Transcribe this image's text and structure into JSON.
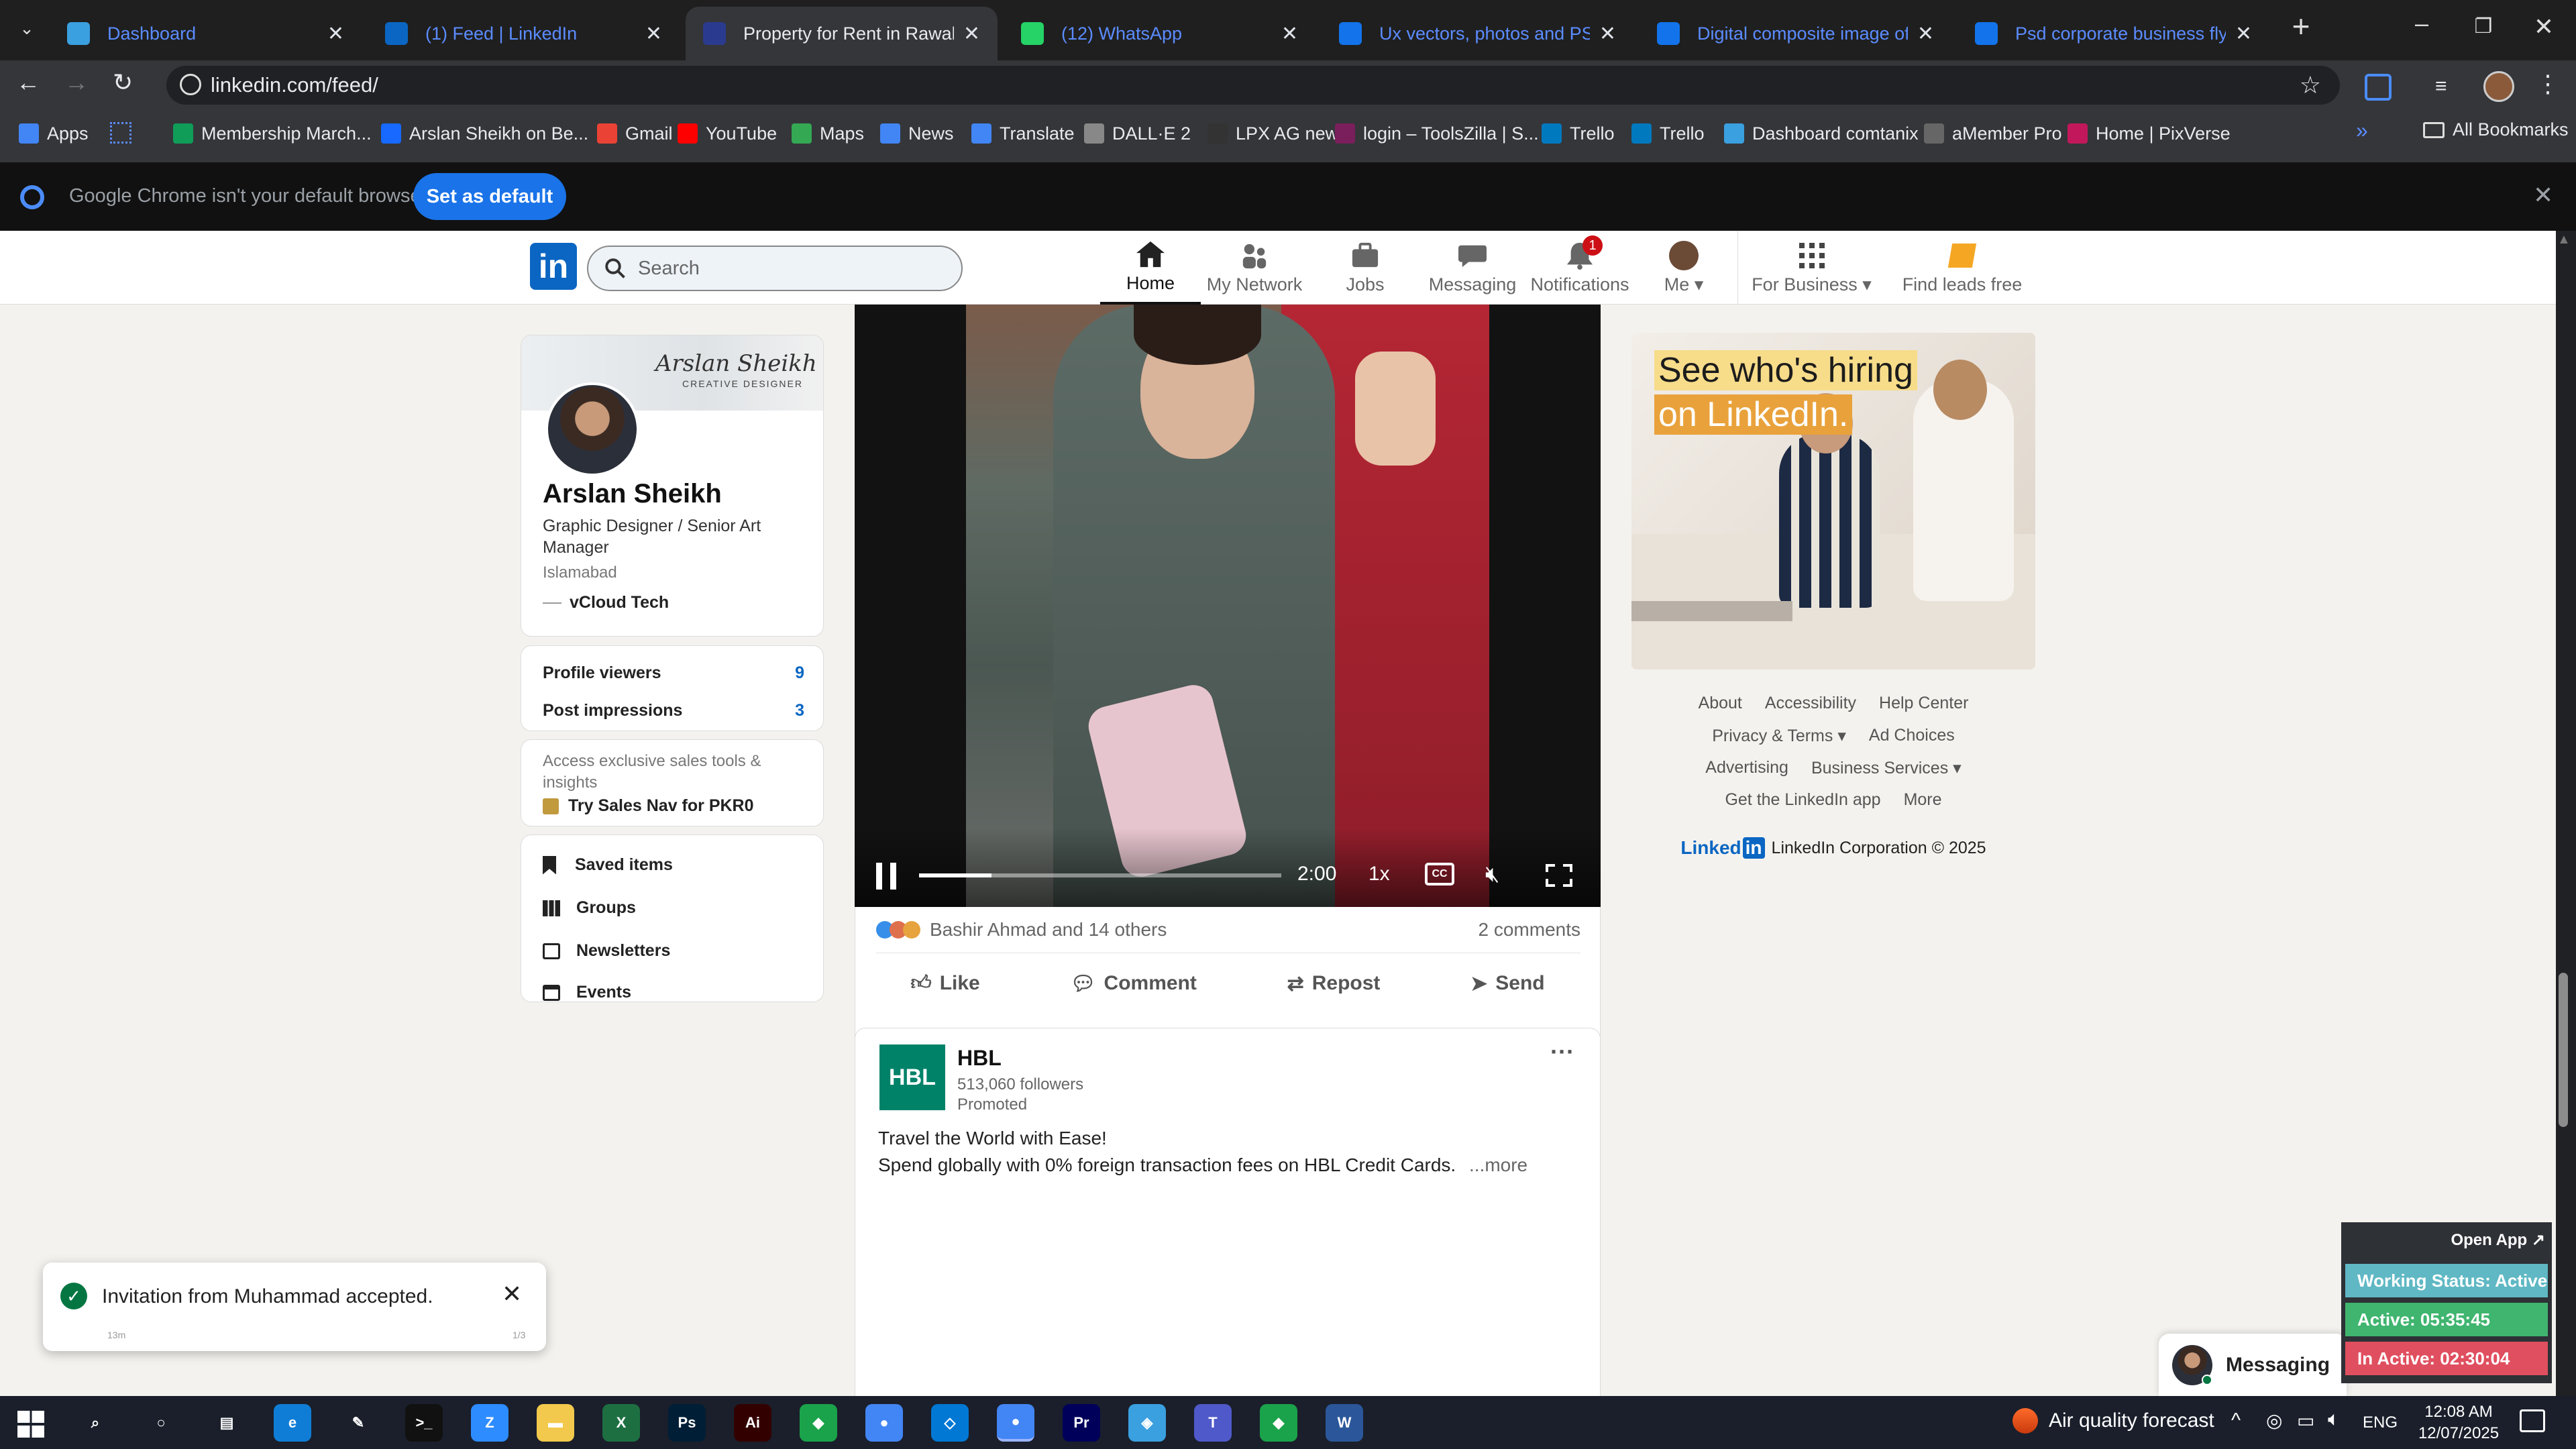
{
  "browser": {
    "tabs": [
      {
        "title": "Dashboard",
        "color": "#3aa0e0",
        "active": false
      },
      {
        "title": "(1) Feed | LinkedIn",
        "color": "#0a66c2",
        "active": false
      },
      {
        "title": "Property for Rent in Rawalpindi",
        "color": "#2a3b8f",
        "active": true
      },
      {
        "title": "(12) WhatsApp",
        "color": "#25d366",
        "active": false
      },
      {
        "title": "Ux vectors, photos and PSD files",
        "color": "#1273eb",
        "active": false
      },
      {
        "title": "Digital composite image of gra",
        "color": "#1273eb",
        "active": false
      },
      {
        "title": "Psd corporate business flyer de",
        "color": "#1273eb",
        "active": false
      }
    ],
    "url": "linkedin.com/feed/",
    "bookmarks": [
      {
        "label": "Apps",
        "color": "#4285f4"
      },
      {
        "label": "Membership March...",
        "color": "#0f9d58"
      },
      {
        "label": "Arslan Sheikh on Be...",
        "color": "#1769ff"
      },
      {
        "label": "Gmail",
        "color": "#ea4335"
      },
      {
        "label": "YouTube",
        "color": "#ff0000"
      },
      {
        "label": "Maps",
        "color": "#34a853"
      },
      {
        "label": "News",
        "color": "#4285f4"
      },
      {
        "label": "Translate",
        "color": "#4285f4"
      },
      {
        "label": "DALL·E 2",
        "color": "#888888"
      },
      {
        "label": "LPX AG new",
        "color": "#333333"
      },
      {
        "label": "login – ToolsZilla | S...",
        "color": "#7a1f5c"
      },
      {
        "label": "Trello",
        "color": "#0079bf"
      },
      {
        "label": "Trello",
        "color": "#0079bf"
      },
      {
        "label": "Dashboard comtanix",
        "color": "#3aa0e0"
      },
      {
        "label": "aMember Pro",
        "color": "#666666"
      },
      {
        "label": "Home | PixVerse",
        "color": "#c2185b"
      }
    ],
    "all_bookmarks": "All Bookmarks",
    "infobar_text": "Google Chrome isn't your default browser",
    "infobar_button": "Set as default"
  },
  "linkedin": {
    "search_placeholder": "Search",
    "nav": {
      "home": "Home",
      "network": "My Network",
      "jobs": "Jobs",
      "messaging": "Messaging",
      "notifications": "Notifications",
      "notifications_badge": "1",
      "me": "Me",
      "business": "For Business",
      "leads": "Find leads free"
    },
    "profile": {
      "banner_name": "Arslan Sheikh",
      "banner_sub": "CREATIVE DESIGNER",
      "name": "Arslan Sheikh",
      "headline": "Graphic Designer / Senior Art Manager",
      "location": "Islamabad",
      "company": "vCloud Tech",
      "viewers_label": "Profile viewers",
      "viewers": "9",
      "impressions_label": "Post impressions",
      "impressions": "3",
      "premium_text": "Access exclusive sales tools & insights",
      "premium_cta": "Try Sales Nav for PKR0"
    },
    "shortcuts": [
      "Saved items",
      "Groups",
      "Newsletters",
      "Events"
    ],
    "video": {
      "time": "2:00",
      "speed": "1x",
      "progress": 0.2
    },
    "post_social": {
      "reactions": "Bashir Ahmad and 14 others",
      "comments": "2 comments",
      "like": "Like",
      "comment": "Comment",
      "repost": "Repost",
      "send": "Send"
    },
    "ad_post": {
      "logo": "HBL",
      "company": "HBL",
      "followers": "513,060 followers",
      "promoted": "Promoted",
      "line1": "Travel the World with Ease!",
      "line2": "Spend globally with 0% foreign transaction fees on HBL Credit Cards.",
      "more": "...more"
    },
    "side_ad": {
      "line1": "See who's hiring",
      "line2": "on LinkedIn."
    },
    "footer": {
      "about": "About",
      "accessibility": "Accessibility",
      "help": "Help Center",
      "privacy": "Privacy & Terms",
      "adchoices": "Ad Choices",
      "advertising": "Advertising",
      "business_services": "Business Services",
      "app": "Get the LinkedIn app",
      "more": "More",
      "brand": "Linked",
      "corp": "LinkedIn Corporation © 2025"
    },
    "toast": {
      "text": "Invitation from Muhammad accepted.",
      "time": "13m",
      "count": "1/3"
    },
    "messaging": "Messaging"
  },
  "tracker": {
    "open_app": "Open App ↗",
    "working": "Working Status: Active",
    "active": "Active: 05:35:45",
    "inactive": "In Active: 02:30:04"
  },
  "taskbar": {
    "weather": "Air quality forecast",
    "lang": "ENG",
    "time": "12:08 AM",
    "date": "12/07/2025",
    "apps": [
      {
        "name": "search",
        "color": "transparent"
      },
      {
        "name": "cortana",
        "color": "transparent"
      },
      {
        "name": "task-view",
        "color": "transparent"
      },
      {
        "name": "edge",
        "color": "#0f7dd6"
      },
      {
        "name": "pen",
        "color": "transparent"
      },
      {
        "name": "terminal",
        "color": "#111111"
      },
      {
        "name": "zoom",
        "color": "#2d8cff"
      },
      {
        "name": "file-explorer",
        "color": "#f2c94c"
      },
      {
        "name": "excel",
        "color": "#1d6f42"
      },
      {
        "name": "photoshop",
        "color": "#001e36"
      },
      {
        "name": "illustrator",
        "color": "#330000"
      },
      {
        "name": "green-app",
        "color": "#1aa34a"
      },
      {
        "name": "chrome",
        "color": "#4285f4"
      },
      {
        "name": "vscode",
        "color": "#0078d4"
      },
      {
        "name": "chrome-active",
        "color": "#4285f4"
      },
      {
        "name": "premiere",
        "color": "#00005b"
      },
      {
        "name": "blue-app",
        "color": "#3aa0e0"
      },
      {
        "name": "teams",
        "color": "#5059c9"
      },
      {
        "name": "green-app-2",
        "color": "#1aa34a"
      },
      {
        "name": "word",
        "color": "#2b579a"
      }
    ]
  }
}
